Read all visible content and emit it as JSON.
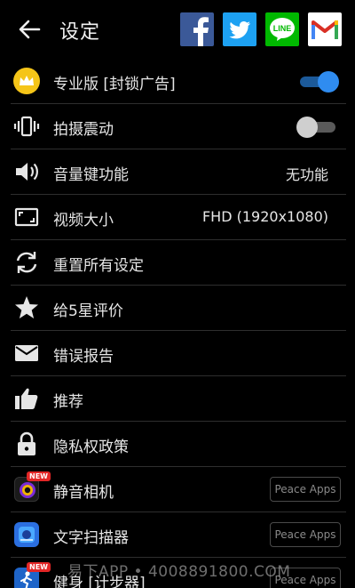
{
  "header": {
    "title": "设定",
    "share_icons": [
      "facebook-icon",
      "twitter-icon",
      "line-icon",
      "gmail-icon"
    ],
    "line_label": "LINE"
  },
  "settings": [
    {
      "label": "专业版 [封锁广告]",
      "icon": "crown-icon",
      "toggle": "on"
    },
    {
      "label": "拍摄震动",
      "icon": "vibrate-icon",
      "toggle": "off"
    },
    {
      "label": "音量键功能",
      "icon": "volume-icon",
      "value": "无功能"
    },
    {
      "label": "视频大小",
      "icon": "aspect-ratio-icon",
      "value": "FHD (1920x1080)"
    },
    {
      "label": "重置所有设定",
      "icon": "reset-icon"
    },
    {
      "label": "给5星评价",
      "icon": "star-icon"
    },
    {
      "label": "错误报告",
      "icon": "mail-icon"
    },
    {
      "label": "推荐",
      "icon": "thumbs-up-icon"
    },
    {
      "label": "隐私权政策",
      "icon": "lock-icon"
    }
  ],
  "apps": [
    {
      "label": "静音相机",
      "icon": "silent-camera-app-icon",
      "badge": "NEW",
      "button": "Peace Apps"
    },
    {
      "label": "文字扫描器",
      "icon": "text-scanner-app-icon",
      "button": "Peace Apps"
    },
    {
      "label": "健身 [计步器]",
      "icon": "fitness-app-icon",
      "badge": "NEW",
      "button": "Peace Apps"
    }
  ],
  "watermark": "易下APP • 4008891800.COM",
  "colors": {
    "background": "#000000",
    "toggle_on": "#2f8cf0",
    "divider": "#2e2e2e",
    "facebook": "#3b5998",
    "twitter": "#1da1f2",
    "line": "#00b900",
    "new_badge": "#e32626"
  }
}
